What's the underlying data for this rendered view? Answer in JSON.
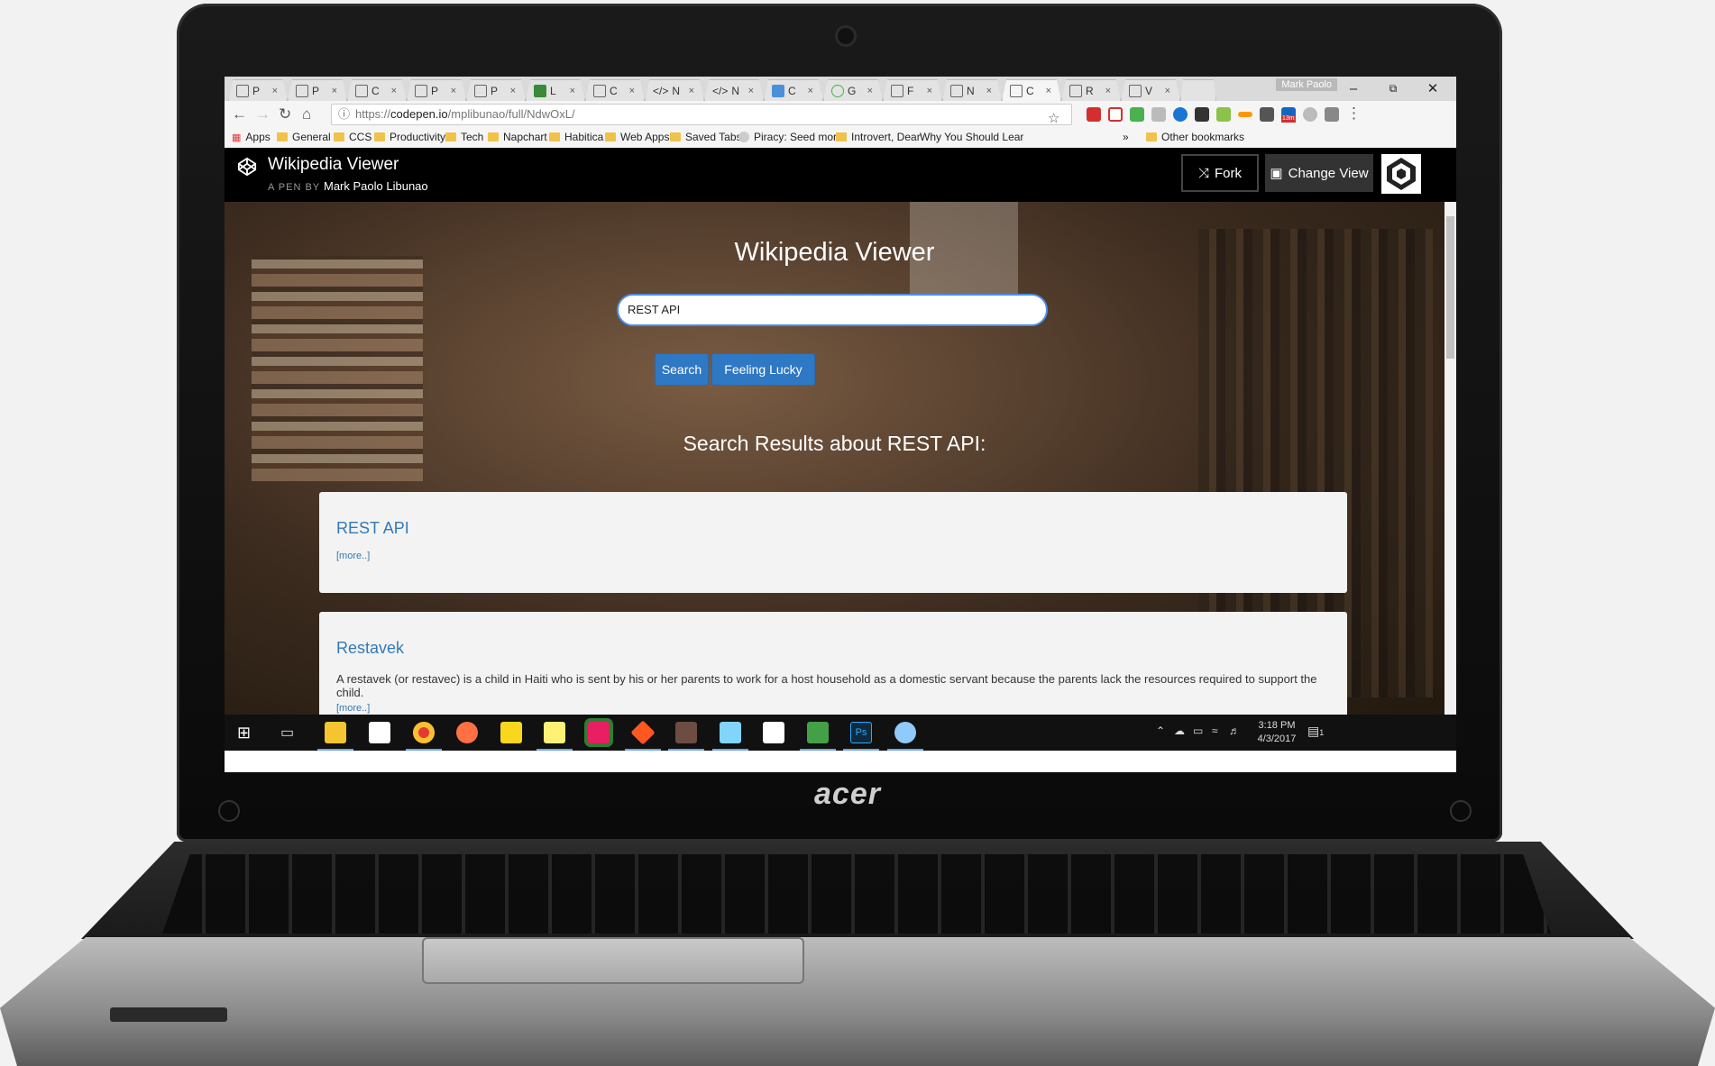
{
  "browser": {
    "tabs": [
      {
        "label": "P"
      },
      {
        "label": "P"
      },
      {
        "label": "C"
      },
      {
        "label": "P"
      },
      {
        "label": "P"
      },
      {
        "label": "L"
      },
      {
        "label": "C"
      },
      {
        "label": "N"
      },
      {
        "label": "N"
      },
      {
        "label": "C"
      },
      {
        "label": "G"
      },
      {
        "label": "F"
      },
      {
        "label": "N"
      },
      {
        "label": "C"
      },
      {
        "label": "R"
      },
      {
        "label": "V"
      }
    ],
    "close_glyph": "×",
    "profile": "Mark Paolo",
    "url_scheme": "https://",
    "url_host": "codepen.io",
    "url_path": "/mplibunao/full/NdwOxL/",
    "bookmarks": [
      {
        "label": "Apps",
        "icon": "apps-grid-icon"
      },
      {
        "label": "General",
        "icon": "folder-icon"
      },
      {
        "label": "CCS",
        "icon": "folder-icon"
      },
      {
        "label": "Productivity",
        "icon": "folder-icon"
      },
      {
        "label": "Tech",
        "icon": "folder-icon"
      },
      {
        "label": "Napchart",
        "icon": "folder-icon"
      },
      {
        "label": "Habitica",
        "icon": "folder-icon"
      },
      {
        "label": "Web Apps",
        "icon": "folder-icon"
      },
      {
        "label": "Saved Tabs",
        "icon": "folder-icon"
      },
      {
        "label": "Piracy: Seed more",
        "icon": "reddit-icon"
      },
      {
        "label": "Introvert, Dear",
        "icon": "site-icon"
      },
      {
        "label": "Why You Should Lear",
        "icon": "site-icon"
      }
    ],
    "overflow_glyph": "»",
    "other_bookmarks": "Other bookmarks",
    "extension_badge": "13m"
  },
  "codepen": {
    "title": "Wikipedia Viewer",
    "by_prefix": "A PEN BY",
    "author": "Mark Paolo Libunao",
    "fork_label": "Fork",
    "change_view_label": "Change View"
  },
  "app": {
    "title": "Wikipedia Viewer",
    "search_value": "REST API",
    "search_button": "Search",
    "lucky_button": "Feeling Lucky",
    "results_heading": "Search Results about REST API:",
    "results": [
      {
        "title": "REST API",
        "snippet": "",
        "more": "[more..]"
      },
      {
        "title": "Restavek",
        "snippet": "A restavek (or restavec) is a child in Haiti who is sent by his or her parents to work for a host household as a domestic servant because the parents lack the resources required to support the child.",
        "more": "[more..]"
      }
    ]
  },
  "taskbar": {
    "time": "3:18 PM",
    "date": "4/3/2017",
    "notification_count": "1"
  },
  "laptop": {
    "brand": "acer"
  },
  "colors": {
    "accent": "#2f78c4",
    "link": "#337ab7",
    "codepen_bar": "#000000"
  }
}
